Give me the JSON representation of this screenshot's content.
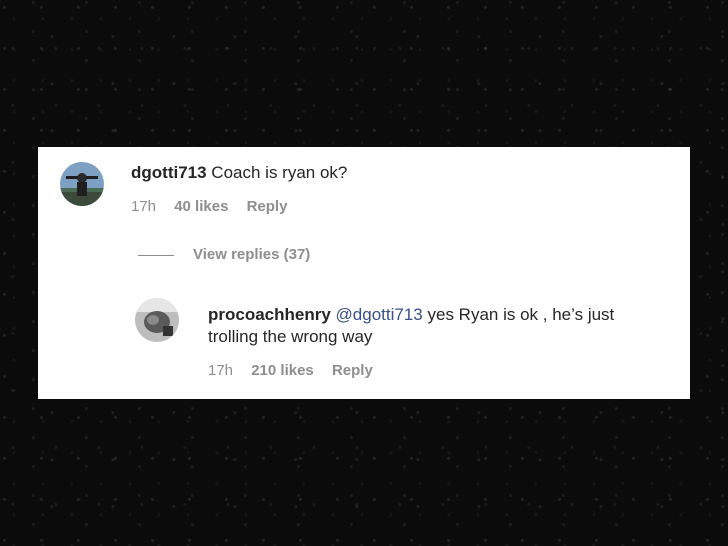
{
  "comment": {
    "username": "dgotti713",
    "text": "Coach is ryan ok?",
    "time": "17h",
    "likes": "40 likes",
    "reply_label": "Reply"
  },
  "view_replies": "View replies (37)",
  "reply": {
    "username": "procoachhenry",
    "mention": "@dgotti713",
    "text_line1": "yes Ryan is ok , he’s just",
    "text_line2": "trolling the wrong way",
    "time": "17h",
    "likes": "210 likes",
    "reply_label": "Reply"
  }
}
